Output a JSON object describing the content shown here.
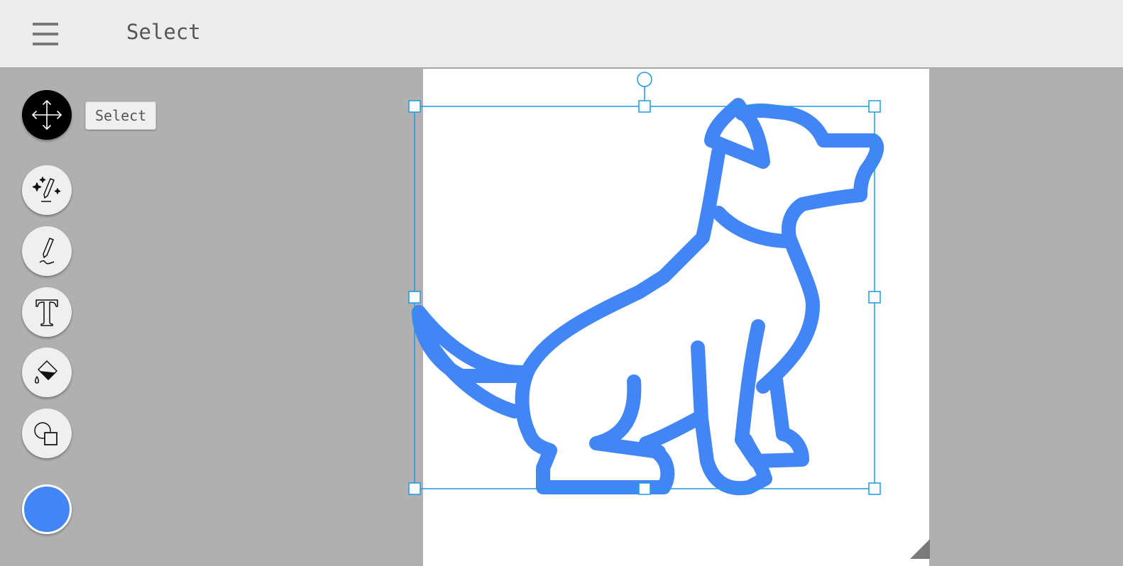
{
  "header": {
    "title": "Select"
  },
  "toolbar": {
    "tools": [
      {
        "name": "select",
        "icon": "move-arrows-icon",
        "active": true
      },
      {
        "name": "magic-draw",
        "icon": "magic-pencil-icon"
      },
      {
        "name": "draw",
        "icon": "pencil-icon"
      },
      {
        "name": "text",
        "icon": "text-icon"
      },
      {
        "name": "fill",
        "icon": "paint-bucket-icon"
      },
      {
        "name": "shapes",
        "icon": "shapes-icon"
      }
    ],
    "tooltip": "Select",
    "current_color": "#4285f4"
  },
  "canvas": {
    "drawing": "dog-outline",
    "stroke_color": "#4285f4",
    "selection_color": "#1a9be0"
  }
}
